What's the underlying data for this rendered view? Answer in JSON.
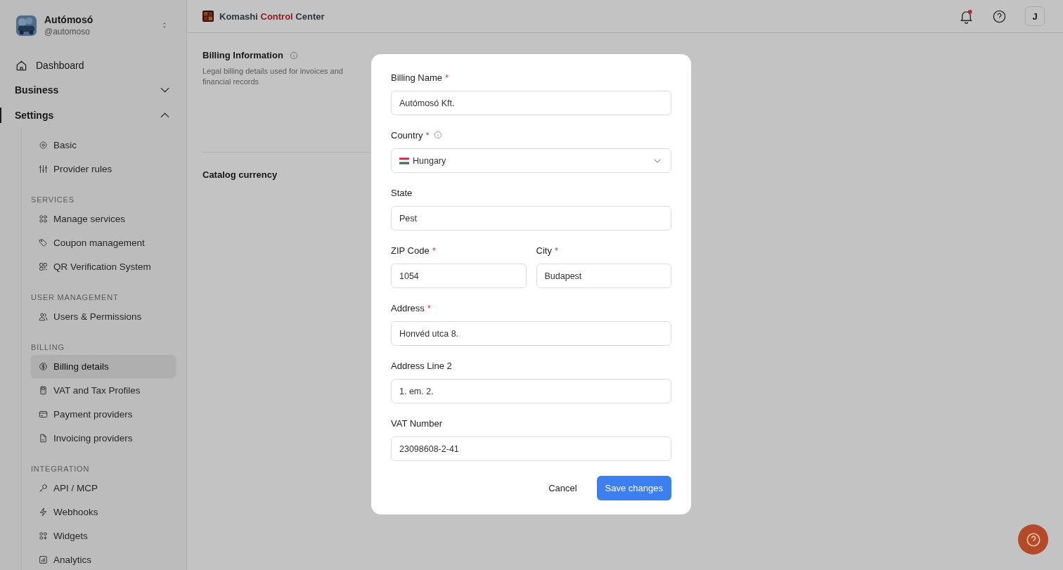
{
  "sidebar": {
    "workspace": {
      "name": "Autómosó",
      "handle": "@automoso"
    },
    "items": [
      {
        "kind": "link",
        "label": "Dashboard",
        "selected": false
      },
      {
        "kind": "group",
        "label": "Business",
        "expanded": false,
        "selected": false
      },
      {
        "kind": "group",
        "label": "Settings",
        "expanded": true,
        "selected": true,
        "children": [
          {
            "kind": "item",
            "label": "Basic",
            "selected": false
          },
          {
            "kind": "item",
            "label": "Provider rules",
            "selected": false
          },
          {
            "kind": "heading",
            "label": "SERVICES"
          },
          {
            "kind": "item",
            "label": "Manage services",
            "selected": false
          },
          {
            "kind": "item",
            "label": "Coupon management",
            "selected": false
          },
          {
            "kind": "item",
            "label": "QR Verification System",
            "selected": false
          },
          {
            "kind": "heading",
            "label": "USER MANAGEMENT"
          },
          {
            "kind": "item",
            "label": "Users & Permissions",
            "selected": false
          },
          {
            "kind": "heading",
            "label": "BILLING"
          },
          {
            "kind": "item",
            "label": "Billing details",
            "selected": true
          },
          {
            "kind": "item",
            "label": "VAT and Tax Profiles",
            "selected": false
          },
          {
            "kind": "item",
            "label": "Payment providers",
            "selected": false
          },
          {
            "kind": "item",
            "label": "Invoicing providers",
            "selected": false
          },
          {
            "kind": "heading",
            "label": "INTEGRATION"
          },
          {
            "kind": "item",
            "label": "API / MCP",
            "selected": false
          },
          {
            "kind": "item",
            "label": "Webhooks",
            "selected": false
          },
          {
            "kind": "item",
            "label": "Widgets",
            "selected": false
          },
          {
            "kind": "item",
            "label": "Analytics",
            "selected": false
          }
        ]
      }
    ]
  },
  "header": {
    "brand": {
      "prefix": "Komashi",
      "accent": "Control",
      "suffix": "Center"
    },
    "notifications_unread": true,
    "avatar": "J"
  },
  "page": {
    "section": {
      "title": "Billing Information",
      "description": "Legal billing details used for invoices and financial records"
    },
    "next_section": {
      "title": "Catalog currency"
    }
  },
  "dialog": {
    "rows": [
      [
        {
          "kind": "text",
          "label": "Billing Name",
          "required_mark": "*",
          "value": "Autómosó Kft."
        }
      ],
      [
        {
          "kind": "select",
          "label": "Country",
          "required_mark": "*",
          "info": true,
          "value": "Hungary"
        }
      ],
      [
        {
          "kind": "text",
          "label": "State",
          "value": "Pest"
        }
      ],
      [
        {
          "kind": "text",
          "label": "ZIP Code",
          "required_mark": "*",
          "value": "1054"
        },
        {
          "kind": "text",
          "label": "City",
          "required_mark": "*",
          "value": "Budapest"
        }
      ],
      [
        {
          "kind": "text",
          "label": "Address",
          "required_mark": "*",
          "value": "Honvéd utca 8."
        }
      ],
      [
        {
          "kind": "text",
          "label": "Address Line 2",
          "value": "1. em. 2."
        }
      ],
      [
        {
          "kind": "text",
          "label": "VAT Number",
          "value": "23098608-2-41"
        }
      ]
    ],
    "buttons": {
      "cancel": "Cancel",
      "save": "Save changes"
    }
  }
}
